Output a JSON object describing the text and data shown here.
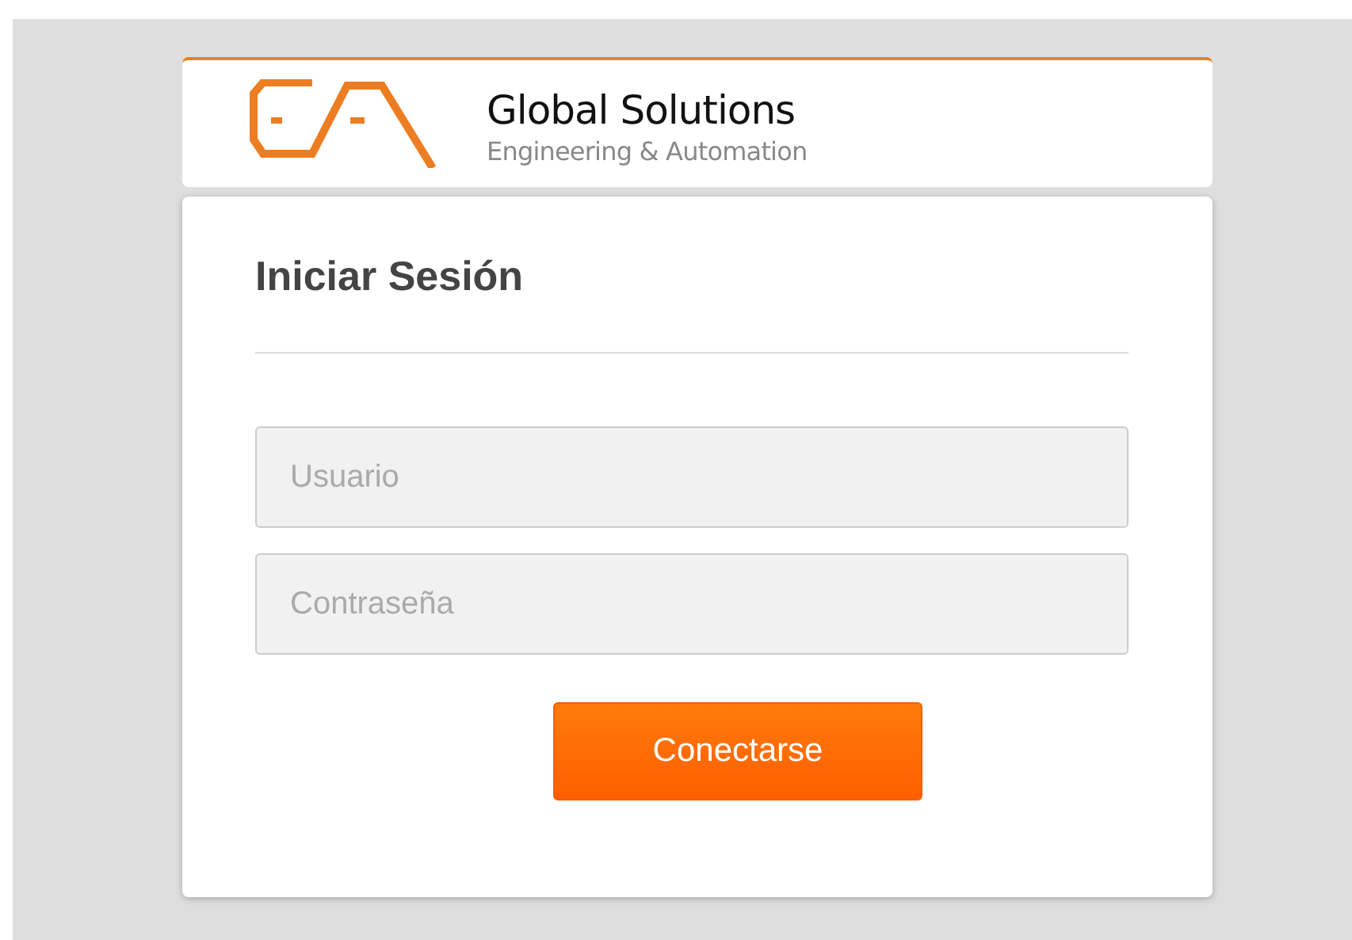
{
  "brand": {
    "name": "Global Solutions",
    "tagline": "Engineering & Automation"
  },
  "login": {
    "title": "Iniciar Sesión",
    "fields": [
      {
        "placeholder": "Usuario"
      },
      {
        "placeholder": "Contraseña"
      }
    ],
    "button": "Conectarse"
  }
}
